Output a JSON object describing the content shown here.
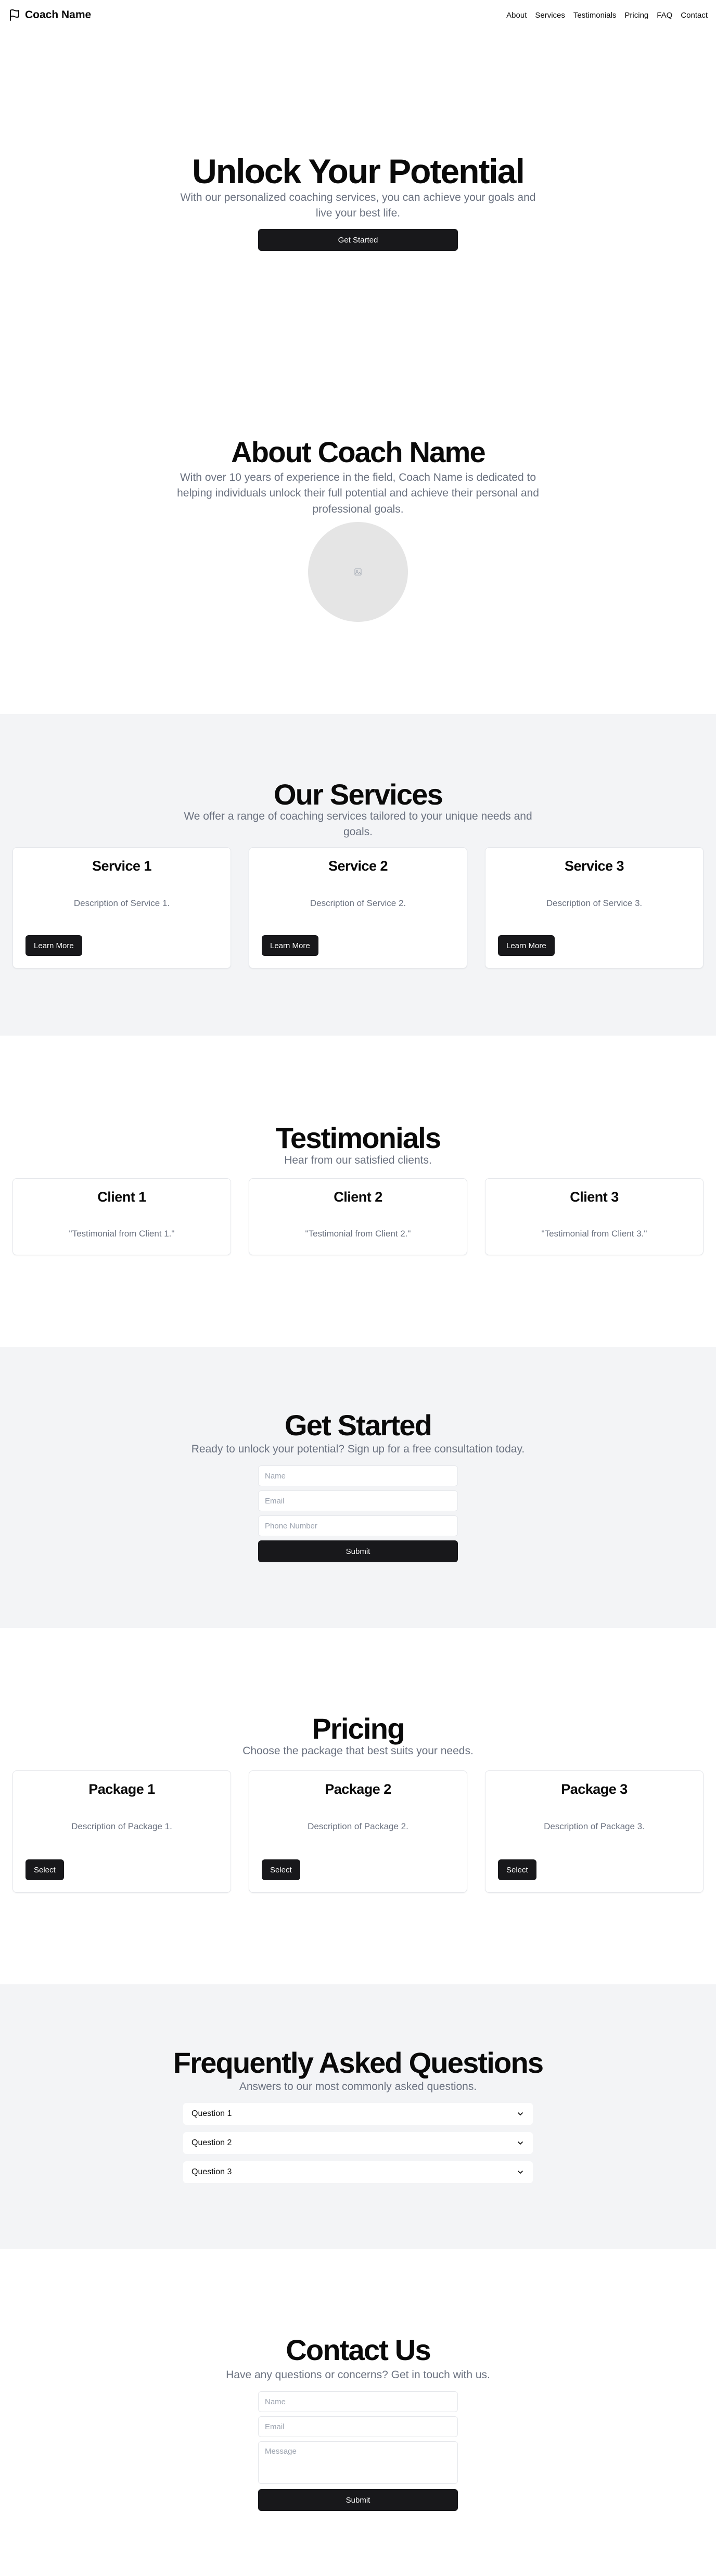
{
  "header": {
    "brand": "Coach Name",
    "nav": [
      "About",
      "Services",
      "Testimonials",
      "Pricing",
      "FAQ",
      "Contact"
    ]
  },
  "hero": {
    "title": "Unlock Your Potential",
    "subtitle": "With our personalized coaching services, you can achieve your goals and live your best life.",
    "cta": "Get Started"
  },
  "about": {
    "title": "About Coach Name",
    "text": "With over 10 years of experience in the field, Coach Name is dedicated to helping individuals unlock their full potential and achieve their personal and professional goals."
  },
  "services": {
    "title": "Our Services",
    "subtitle": "We offer a range of coaching services tailored to your unique needs and goals.",
    "items": [
      {
        "title": "Service 1",
        "desc": "Description of Service 1.",
        "button": "Learn More"
      },
      {
        "title": "Service 2",
        "desc": "Description of Service 2.",
        "button": "Learn More"
      },
      {
        "title": "Service 3",
        "desc": "Description of Service 3.",
        "button": "Learn More"
      }
    ]
  },
  "testimonials": {
    "title": "Testimonials",
    "subtitle": "Hear from our satisfied clients.",
    "items": [
      {
        "name": "Client 1",
        "quote": "\"Testimonial from Client 1.\""
      },
      {
        "name": "Client 2",
        "quote": "\"Testimonial from Client 2.\""
      },
      {
        "name": "Client 3",
        "quote": "\"Testimonial from Client 3.\""
      }
    ]
  },
  "get_started": {
    "title": "Get Started",
    "subtitle": "Ready to unlock your potential? Sign up for a free consultation today.",
    "name_placeholder": "Name",
    "email_placeholder": "Email",
    "phone_placeholder": "Phone Number",
    "submit": "Submit"
  },
  "pricing": {
    "title": "Pricing",
    "subtitle": "Choose the package that best suits your needs.",
    "items": [
      {
        "title": "Package 1",
        "desc": "Description of Package 1.",
        "button": "Select"
      },
      {
        "title": "Package 2",
        "desc": "Description of Package 2.",
        "button": "Select"
      },
      {
        "title": "Package 3",
        "desc": "Description of Package 3.",
        "button": "Select"
      }
    ]
  },
  "faq": {
    "title": "Frequently Asked Questions",
    "subtitle": "Answers to our most commonly asked questions.",
    "items": [
      "Question 1",
      "Question 2",
      "Question 3"
    ]
  },
  "contact": {
    "title": "Contact Us",
    "subtitle": "Have any questions or concerns? Get in touch with us.",
    "name_placeholder": "Name",
    "email_placeholder": "Email",
    "message_placeholder": "Message",
    "submit": "Submit"
  },
  "colors": {
    "primary": "#18181b",
    "muted_text": "#6b7280",
    "section_gray": "#f3f4f6"
  },
  "icons": {
    "brand": "flag-icon",
    "avatar": "image-placeholder-icon",
    "faq": "chevron-down-icon"
  }
}
